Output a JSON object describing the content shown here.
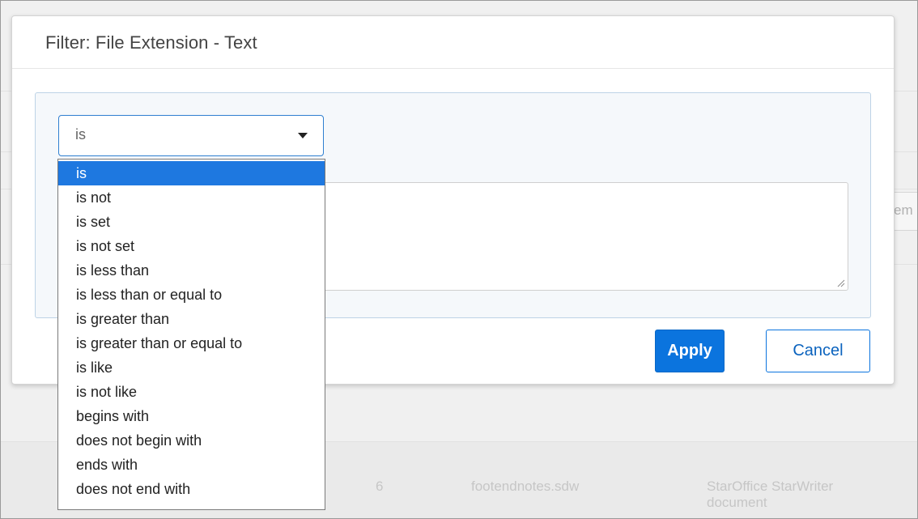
{
  "modal": {
    "title": "Filter: File Extension - Text",
    "operator_select": {
      "value": "is",
      "options": [
        "is",
        "is not",
        "is set",
        "is not set",
        "is less than",
        "is less than or equal to",
        "is greater than",
        "is greater than or equal to",
        "is like",
        "is not like",
        "begins with",
        "does not begin with",
        "ends with",
        "does not end with"
      ],
      "selected_index": 0
    },
    "value_textarea": {
      "value": ""
    },
    "apply_label": "Apply",
    "cancel_label": "Cancel"
  },
  "background": {
    "partial_input_text": "em",
    "row": {
      "number": "6",
      "filename": "footendnotes.sdw",
      "type_line1": "StarOffice StarWriter",
      "type_line2": "document"
    }
  },
  "colors": {
    "primary": "#0b74de",
    "selected_option": "#1e78e0",
    "panel_background": "#f5f8fb",
    "panel_border": "#bdd3e6"
  }
}
